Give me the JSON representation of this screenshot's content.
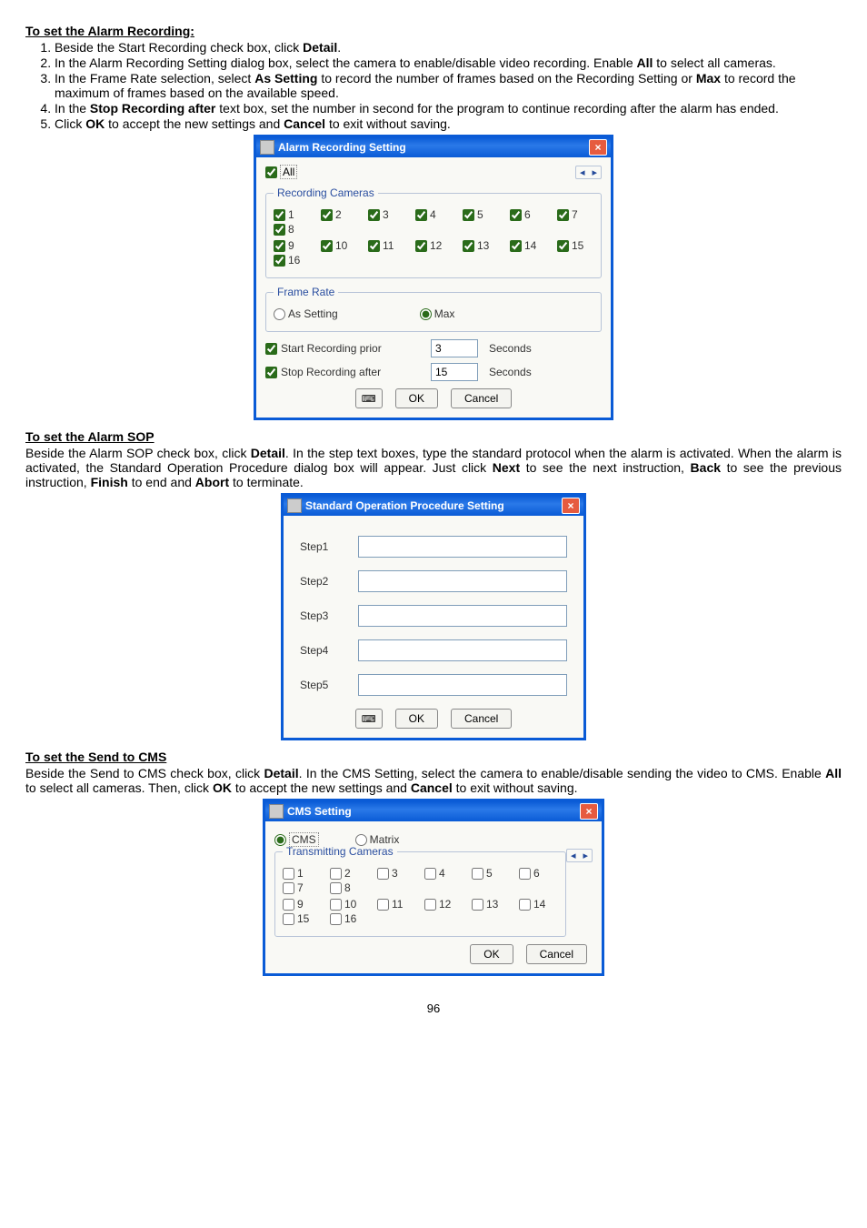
{
  "section1": {
    "heading": "To set the Alarm Recording:",
    "items": {
      "1": "Beside the Start Recording check box, click",
      "1b": "Detail",
      "1c": ".",
      "2a": "In the Alarm Recording Setting dialog box, select the camera to enable/disable video recording. Enable",
      "2b": "All",
      "2c": "to select all cameras.",
      "3a": "In the Frame Rate selection, select",
      "3b": "As Setting",
      "3c": "to record the number of frames based on the Recording Setting or",
      "3d": "Max",
      "3e": "to record the maximum of frames based on the available speed.",
      "4a": "In the",
      "4b": "Stop Recording after",
      "4c": "text box, set the number in second for the program to continue recording after the alarm has ended.",
      "5a": "Click",
      "5b": "OK",
      "5c": "to accept the new settings and",
      "5d": "Cancel",
      "5e": "to exit without saving."
    }
  },
  "alarmDlg": {
    "title": "Alarm Recording Setting",
    "allLabel": "All",
    "recCamsLegend": "Recording Cameras",
    "cams": [
      "1",
      "2",
      "3",
      "4",
      "5",
      "6",
      "7",
      "8",
      "9",
      "10",
      "11",
      "12",
      "13",
      "14",
      "15",
      "16"
    ],
    "frameLegend": "Frame Rate",
    "asSetting": "As Setting",
    "max": "Max",
    "startPrior": "Start Recording prior",
    "stopAfter": "Stop Recording after",
    "priorVal": "3",
    "afterVal": "15",
    "seconds": "Seconds",
    "ok": "OK",
    "cancel": "Cancel"
  },
  "section2": {
    "heading": "To set the Alarm SOP",
    "body1": "Beside the Alarm SOP check box, click",
    "bold1": "Detail",
    "body2": ". In the step text boxes, type the standard protocol when the alarm is activated. When the alarm is activated, the Standard Operation Procedure dialog box will appear. Just click",
    "bold2": "Next",
    "body3": "to see the next instruction,",
    "bold3": "Back",
    "body4": "to see the previous instruction,",
    "bold4": "Finish",
    "body5": "to end and",
    "bold5": "Abort",
    "body6": "to terminate."
  },
  "sopDlg": {
    "title": "Standard Operation Procedure Setting",
    "steps": [
      "Step1",
      "Step2",
      "Step3",
      "Step4",
      "Step5"
    ],
    "ok": "OK",
    "cancel": "Cancel"
  },
  "section3": {
    "heading": "To set the Send to CMS",
    "body1": "Beside the Send to CMS check box, click",
    "bold1": "Detail",
    "body2": ". In the CMS Setting, select the camera to enable/disable sending the video to CMS. Enable",
    "bold2": "All",
    "body3": "to select all cameras. Then, click",
    "bold3": "OK",
    "body4": "to accept the new settings and",
    "bold4": "Cancel",
    "body5": "to exit without saving."
  },
  "cmsDlg": {
    "title": "CMS Setting",
    "cms": "CMS",
    "matrix": "Matrix",
    "transLegend": "Transmitting Cameras",
    "cams": [
      "1",
      "2",
      "3",
      "4",
      "5",
      "6",
      "7",
      "8",
      "9",
      "10",
      "11",
      "12",
      "13",
      "14",
      "15",
      "16"
    ],
    "ok": "OK",
    "cancel": "Cancel"
  },
  "pageNum": "96"
}
